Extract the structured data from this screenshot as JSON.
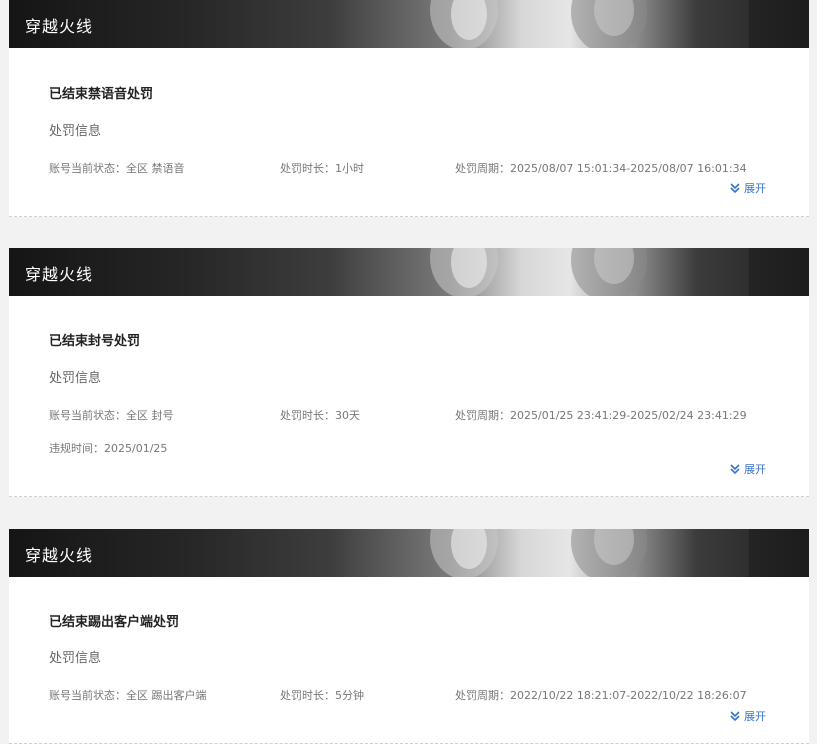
{
  "colors": {
    "accent": "#3a74c9",
    "card_bg": "#ffffff",
    "page_bg": "#f2f2f2",
    "text_dark": "#222222",
    "text_muted": "#777777"
  },
  "labels": {
    "status_prefix": "账号当前状态：",
    "duration_prefix": "处罚时长：",
    "period_prefix": "处罚周期：",
    "violation_prefix": "违规时间：",
    "section": "处罚信息",
    "expand": "展开",
    "expand_icon": "double-chevron-down-icon"
  },
  "cards": [
    {
      "game": "穿越火线",
      "title": "已结束禁语音处罚",
      "status": "全区 禁语音",
      "duration": "1小时",
      "period": "2025/08/07 15:01:34-2025/08/07 16:01:34",
      "violation_time": null
    },
    {
      "game": "穿越火线",
      "title": "已结束封号处罚",
      "status": "全区 封号",
      "duration": "30天",
      "period": "2025/01/25 23:41:29-2025/02/24 23:41:29",
      "violation_time": "2025/01/25"
    },
    {
      "game": "穿越火线",
      "title": "已结束踢出客户端处罚",
      "status": "全区 踢出客户端",
      "duration": "5分钟",
      "period": "2022/10/22 18:21:07-2022/10/22 18:26:07",
      "violation_time": null
    }
  ]
}
